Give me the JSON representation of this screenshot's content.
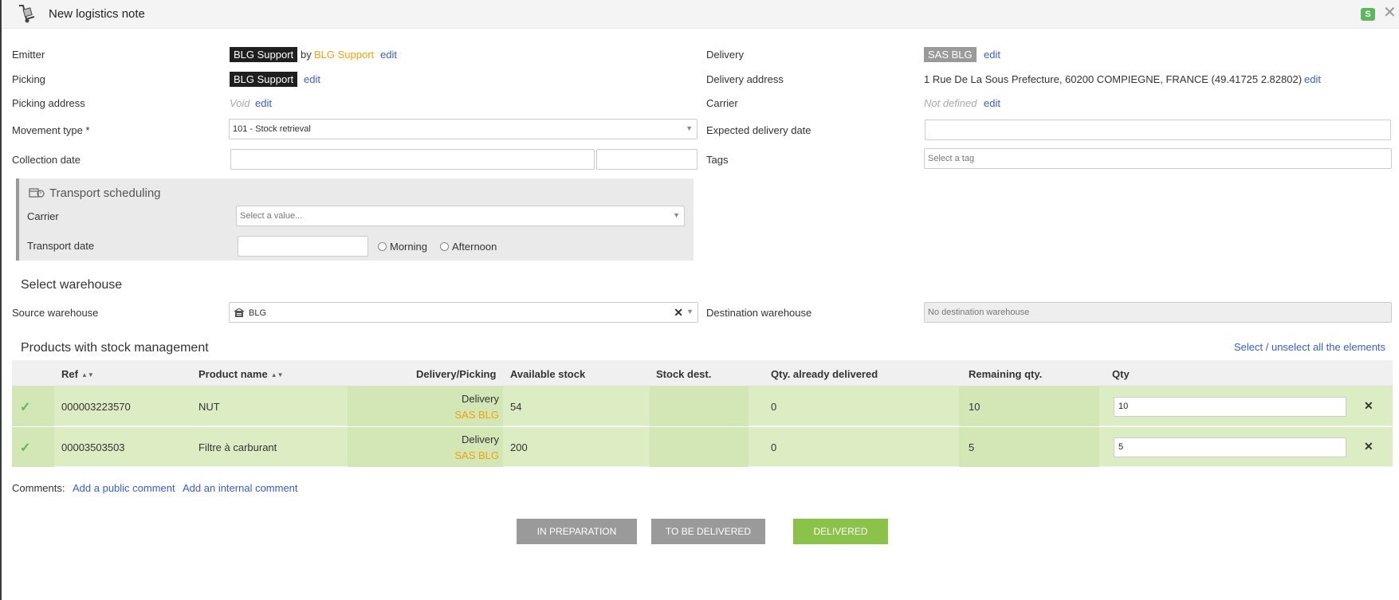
{
  "window": {
    "title": "New logistics note",
    "badge": "S",
    "close_label": "✕"
  },
  "form": {
    "emitter": {
      "label": "Emitter",
      "chip": "BLG Support",
      "by": "by",
      "by_name": "BLG Support",
      "edit": "edit"
    },
    "picking": {
      "label": "Picking",
      "chip": "BLG Support",
      "edit": "edit"
    },
    "picking_address": {
      "label": "Picking address",
      "value": "Void",
      "edit": "edit"
    },
    "movement_type": {
      "label": "Movement type *",
      "value": "101 - Stock retrieval"
    },
    "collection_date": {
      "label": "Collection date"
    },
    "delivery": {
      "label": "Delivery",
      "chip": "SAS BLG",
      "edit": "edit"
    },
    "delivery_address": {
      "label": "Delivery address",
      "value": "1 Rue De La Sous Prefecture, 60200 COMPIEGNE, FRANCE (49.41725 2.82802)",
      "edit": "edit"
    },
    "carrier": {
      "label": "Carrier",
      "value": "Not defined",
      "edit": "edit"
    },
    "expected_delivery_date": {
      "label": "Expected delivery date"
    },
    "tags": {
      "label": "Tags",
      "placeholder": "Select a tag"
    }
  },
  "transport": {
    "title": "Transport scheduling",
    "carrier_label": "Carrier",
    "carrier_placeholder": "Select a value...",
    "date_label": "Transport date",
    "morning": "Morning",
    "afternoon": "Afternoon"
  },
  "warehouse": {
    "section_title": "Select warehouse",
    "source_label": "Source warehouse",
    "source_value": "BLG",
    "destination_label": "Destination warehouse",
    "destination_value": "No destination warehouse"
  },
  "products": {
    "section_title": "Products with stock management",
    "select_all": "Select / unselect all the elements",
    "columns": [
      "Ref",
      "Product name",
      "Delivery/Picking",
      "Available stock",
      "Stock dest.",
      "Qty. already delivered",
      "Remaining qty.",
      "Qty"
    ],
    "rows": [
      {
        "ref": "000003223570",
        "name": "NUT",
        "dp_type": "Delivery",
        "dp_name": "SAS BLG",
        "available": "54",
        "stock_dest": "",
        "already": "0",
        "remaining": "10",
        "qty": "10"
      },
      {
        "ref": "00003503503",
        "name": "Filtre à carburant",
        "dp_type": "Delivery",
        "dp_name": "SAS BLG",
        "available": "200",
        "stock_dest": "",
        "already": "0",
        "remaining": "5",
        "qty": "5"
      }
    ]
  },
  "comments": {
    "label": "Comments:",
    "public": "Add a public comment",
    "internal": "Add an internal comment"
  },
  "status_buttons": [
    {
      "label": "IN PREPARATION",
      "color": "#9a9a9a"
    },
    {
      "label": "TO BE DELIVERED",
      "color": "#9a9a9a"
    },
    {
      "label": "DELIVERED",
      "color": "#8bc34a"
    }
  ]
}
